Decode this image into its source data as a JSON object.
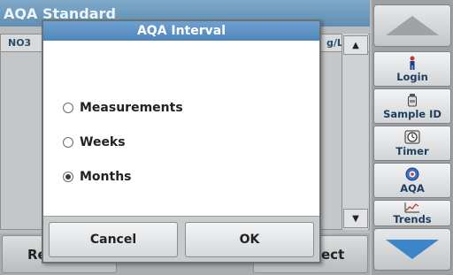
{
  "background": {
    "title": "AQA Standard",
    "list": {
      "col1": "NO3",
      "col2": "g/L"
    },
    "bottom_buttons": {
      "left": "Re",
      "right": "ect"
    }
  },
  "side_panel": {
    "buttons": [
      {
        "label": "Login",
        "icon": "person-icon"
      },
      {
        "label": "Sample ID",
        "icon": "sample-bottle-icon"
      },
      {
        "label": "Timer",
        "icon": "timer-icon"
      },
      {
        "label": "AQA",
        "icon": "aqa-icon"
      },
      {
        "label": "Trends",
        "icon": "trends-icon"
      }
    ]
  },
  "dialog": {
    "title": "AQA Interval",
    "options": [
      {
        "label": "Measurements",
        "selected": false
      },
      {
        "label": "Weeks",
        "selected": false
      },
      {
        "label": "Months",
        "selected": true
      }
    ],
    "cancel_label": "Cancel",
    "ok_label": "OK"
  },
  "colors": {
    "title_bar": "#5f8fb3",
    "dialog_title": "#4f86bb",
    "down_arrow": "#3b86c8"
  }
}
